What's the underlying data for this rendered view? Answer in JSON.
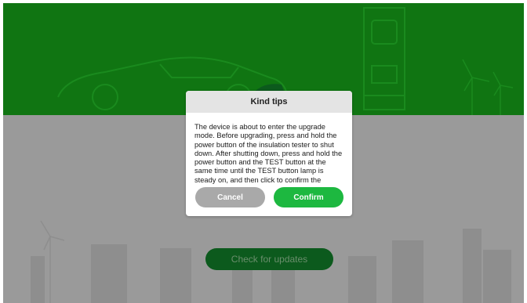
{
  "main": {
    "check_updates_label": "Check for updates"
  },
  "dialog": {
    "title": "Kind tips",
    "message": "The device is about to enter the upgrade mode. Before upgrading, press and hold the power button of the insulation tester to shut down. After shutting down, press and hold the power button and the TEST button at the same time until the TEST button lamp is steady on, and then click to confirm the upgrade.",
    "cancel_label": "Cancel",
    "confirm_label": "Confirm"
  },
  "colors": {
    "banner": "#107512",
    "overlay_gray": "#9a9a9a",
    "confirm_button": "#1db840",
    "cancel_button": "#a9a9a9",
    "update_button": "#0c5a1d"
  },
  "icons": [
    "car-illustration",
    "charging-station-illustration",
    "wind-turbine-icon",
    "city-skyline-illustration"
  ]
}
